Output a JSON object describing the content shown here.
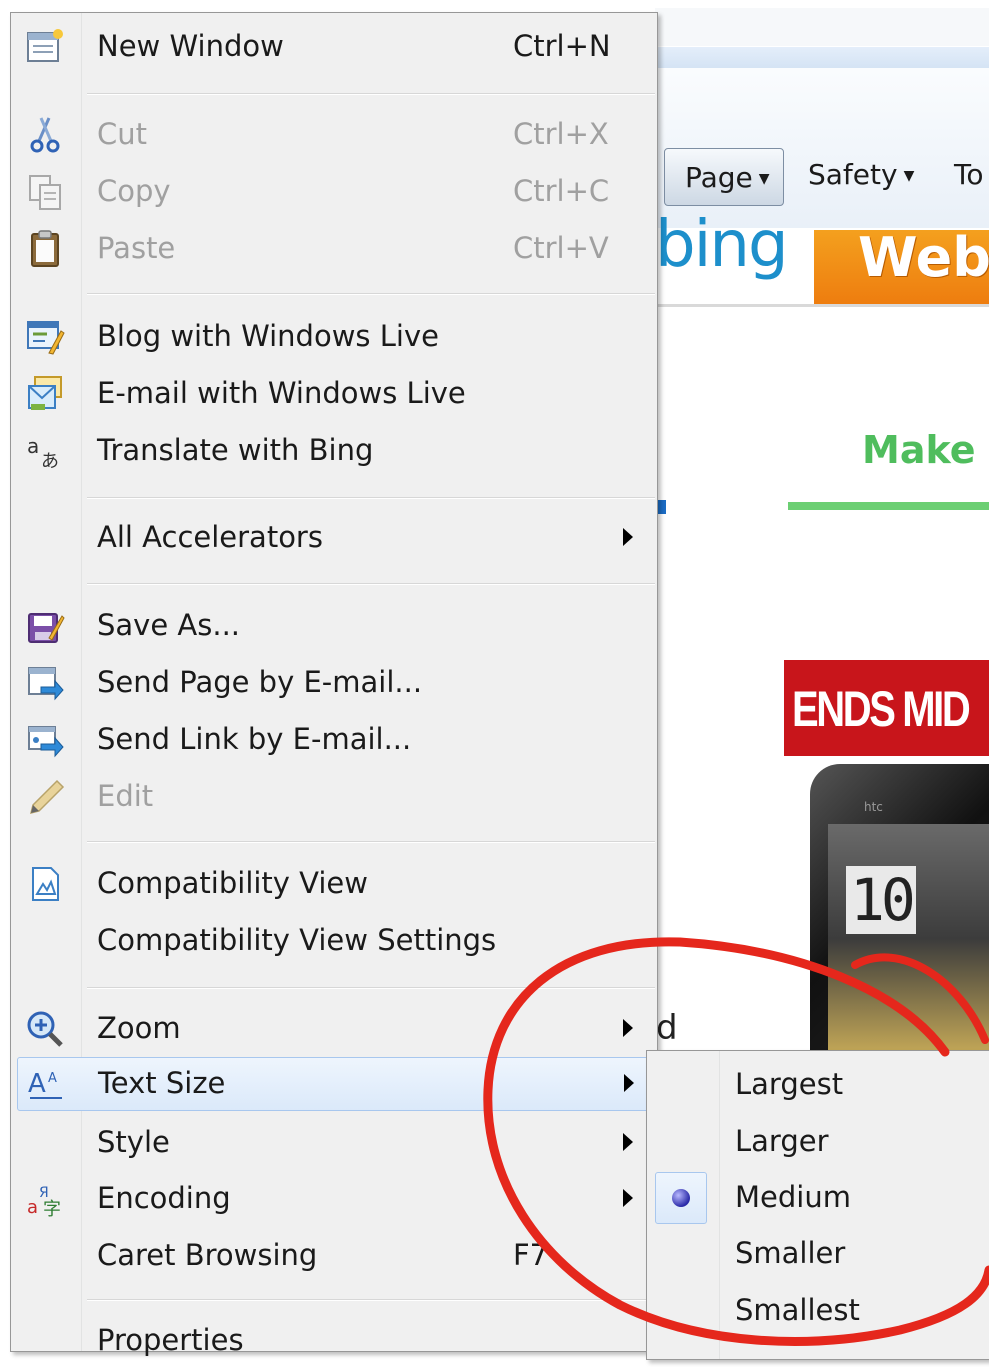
{
  "browser": {
    "commands": {
      "page": "Page",
      "safety": "Safety",
      "tools": "To"
    },
    "bing_logo": "bing",
    "web_tab": "Web",
    "headline": "Make N",
    "ad_text": "ENDS MID",
    "ad_clock": "10",
    "ad_brand": "htc",
    "stray_text": "d"
  },
  "menu": {
    "items": [
      {
        "label": "New Window",
        "shortcut": "Ctrl+N",
        "icon": "new-window-icon",
        "disabled": false
      },
      {
        "label": "Cut",
        "shortcut": "Ctrl+X",
        "icon": "scissors-icon",
        "disabled": true
      },
      {
        "label": "Copy",
        "shortcut": "Ctrl+C",
        "icon": "copy-icon",
        "disabled": true
      },
      {
        "label": "Paste",
        "shortcut": "Ctrl+V",
        "icon": "clipboard-icon",
        "disabled": true
      },
      {
        "label": "Blog with Windows Live",
        "icon": "blog-icon",
        "disabled": false
      },
      {
        "label": "E-mail with Windows Live",
        "icon": "email-live-icon",
        "disabled": false
      },
      {
        "label": "Translate with Bing",
        "icon": "translate-icon",
        "disabled": false
      },
      {
        "label": "All Accelerators",
        "submenu": true,
        "disabled": false
      },
      {
        "label": "Save As...",
        "icon": "save-icon",
        "disabled": false
      },
      {
        "label": "Send Page by E-mail...",
        "icon": "send-page-icon",
        "disabled": false
      },
      {
        "label": "Send Link by E-mail...",
        "icon": "send-link-icon",
        "disabled": false
      },
      {
        "label": "Edit",
        "icon": "pencil-icon",
        "disabled": true
      },
      {
        "label": "Compatibility View",
        "icon": "compatibility-icon",
        "disabled": false
      },
      {
        "label": "Compatibility View Settings",
        "disabled": false
      },
      {
        "label": "Zoom",
        "icon": "zoom-icon",
        "submenu": true,
        "disabled": false
      },
      {
        "label": "Text Size",
        "icon": "text-size-icon",
        "submenu": true,
        "highlighted": true,
        "disabled": false
      },
      {
        "label": "Style",
        "submenu": true,
        "disabled": false
      },
      {
        "label": "Encoding",
        "icon": "encoding-icon",
        "submenu": true,
        "disabled": false
      },
      {
        "label": "Caret Browsing",
        "shortcut": "F7",
        "disabled": false
      },
      {
        "label": "Properties",
        "disabled": false
      }
    ]
  },
  "text_size_submenu": {
    "items": [
      "Largest",
      "Larger",
      "Medium",
      "Smaller",
      "Smallest"
    ],
    "selected": "Medium"
  },
  "colors": {
    "annotation": "#e5271c",
    "highlight_border": "#a8c7ee",
    "menu_background": "#f0f0f0",
    "disabled_text": "#a0a0a0"
  }
}
